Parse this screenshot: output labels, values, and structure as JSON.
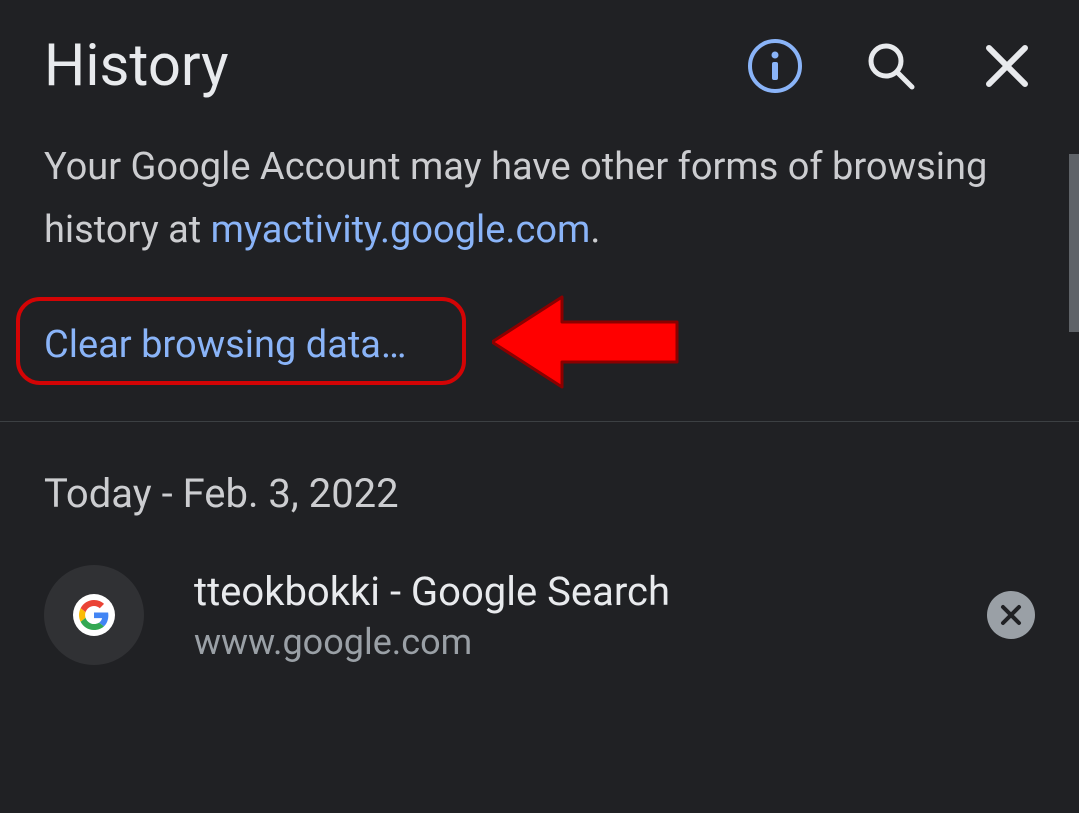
{
  "header": {
    "title": "History"
  },
  "info": {
    "text_pre": "Your Google Account may have other forms of browsing history at ",
    "link": "myactivity.google.com",
    "text_post": "."
  },
  "clear": {
    "label": "Clear browsing data…"
  },
  "date": {
    "label": "Today - Feb. 3, 2022"
  },
  "history": [
    {
      "title": "tteokbokki - Google Search",
      "url": "www.google.com"
    }
  ]
}
